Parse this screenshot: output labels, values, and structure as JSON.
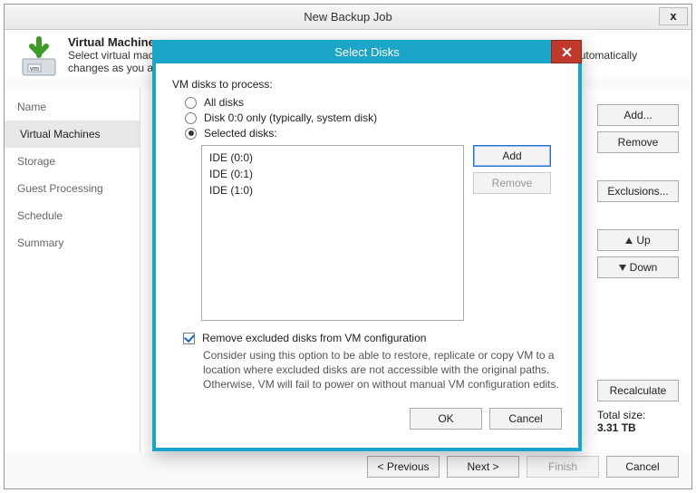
{
  "wizard": {
    "title": "New Backup Job",
    "header": {
      "title": "Virtual Machines",
      "desc": "Select virtual machines to process via container, or granularly. Container provides dynamic selection that automatically changes as you add new VM into container."
    },
    "steps": [
      "Name",
      "Virtual Machines",
      "Storage",
      "Guest Processing",
      "Schedule",
      "Summary"
    ],
    "active_step": 1,
    "side_buttons": {
      "add": "Add...",
      "remove": "Remove",
      "exclusions": "Exclusions...",
      "up": "Up",
      "down": "Down",
      "recalc": "Recalculate"
    },
    "total": {
      "label": "Total size:",
      "value": "3.31 TB"
    },
    "footer": {
      "prev": "< Previous",
      "next": "Next >",
      "finish": "Finish",
      "cancel": "Cancel"
    }
  },
  "modal": {
    "title": "Select Disks",
    "section_label": "VM disks to process:",
    "options": {
      "all": "All disks",
      "disk0": "Disk 0:0 only (typically, system disk)",
      "selected": "Selected disks:"
    },
    "selected_option": "selected",
    "disks": [
      "IDE (0:0)",
      "IDE (0:1)",
      "IDE (1:0)"
    ],
    "buttons": {
      "add": "Add",
      "remove": "Remove"
    },
    "checkbox_label": "Remove excluded disks from VM configuration",
    "checkbox_checked": true,
    "helper": "Consider using this option to be able to restore, replicate or copy VM to a location where excluded disks are not accessible with the original paths. Otherwise, VM will fail to power on without manual VM configuration edits.",
    "footer": {
      "ok": "OK",
      "cancel": "Cancel"
    }
  }
}
